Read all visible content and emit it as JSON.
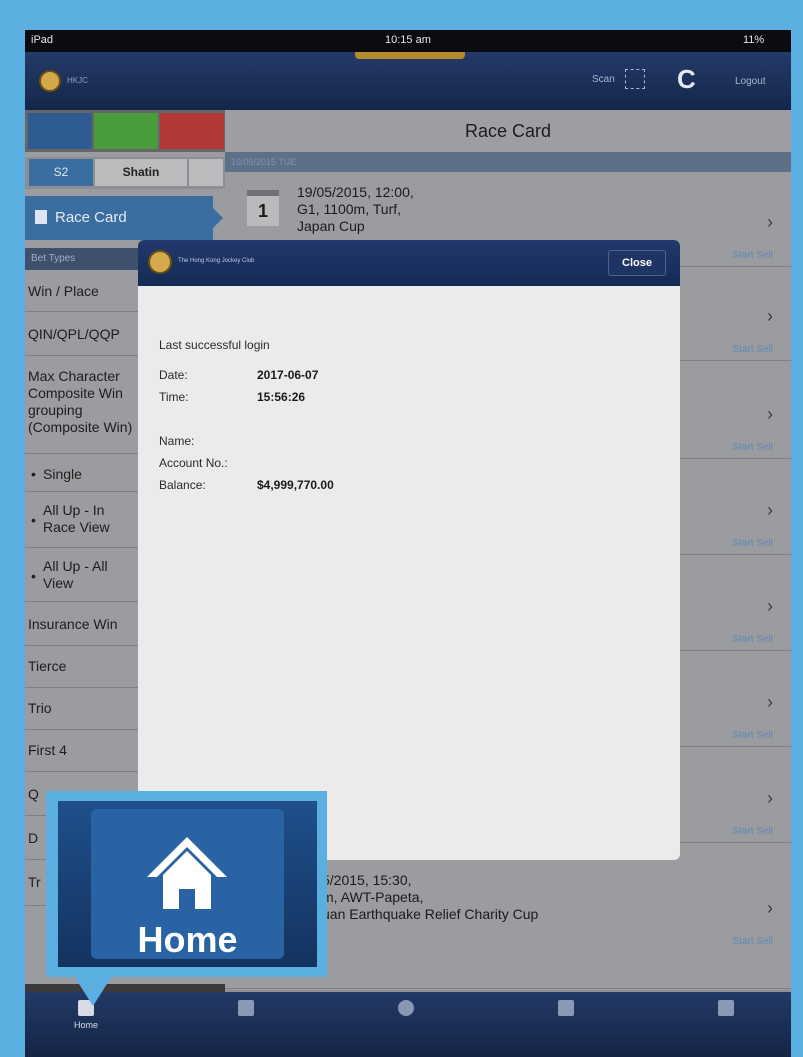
{
  "status_bar": {
    "carrier": "iPad",
    "time": "10:15 am",
    "battery": "11%"
  },
  "header": {
    "brand": "HKJC",
    "scan_label": "Scan",
    "logout_label": "Logout"
  },
  "left_panel": {
    "segment_left": "S2",
    "segment_right": "Shatin",
    "race_card_label": "Race Card",
    "bet_types_header": "Bet Types",
    "bet_types": [
      {
        "label": "Win / Place"
      },
      {
        "label": "QIN/QPL/QQP"
      },
      {
        "label": "Max Character Composite Win grouping (Composite Win)"
      },
      {
        "label": "Single"
      },
      {
        "label": "All Up - In Race View"
      },
      {
        "label": "All Up - All View"
      },
      {
        "label": "Insurance Win"
      },
      {
        "label": "Tierce"
      },
      {
        "label": "Trio"
      },
      {
        "label": "First 4"
      },
      {
        "label": "Q"
      },
      {
        "label": "D"
      },
      {
        "label": "Tr"
      }
    ],
    "results_label": "Results and Dividends"
  },
  "right_panel": {
    "title": "Race Card",
    "subheader": "19/05/2015 TUE",
    "race1": {
      "number": "1",
      "line1": "19/05/2015, 12:00,",
      "line2": "G1, 1100m, Turf,",
      "line3": "Japan Cup"
    },
    "race_last": {
      "line1": "5/2015, 15:30,",
      "line2": "m, AWT-Papeta,",
      "line3": "uan Earthquake Relief Charity Cup"
    },
    "start_sell_label": "Start Sell"
  },
  "dialog": {
    "brand": "The Hong Kong Jockey Club",
    "close_label": "Close",
    "heading": "Last successful login",
    "date_label": "Date:",
    "date_value": "2017-06-07",
    "time_label": "Time:",
    "time_value": "15:56:26",
    "name_label": "Name:",
    "account_label": "Account No.:",
    "balance_label": "Balance:",
    "balance_value": "$4,999,770.00"
  },
  "callout": {
    "label": "Home"
  },
  "tabbar": {
    "home_label": "Home"
  }
}
